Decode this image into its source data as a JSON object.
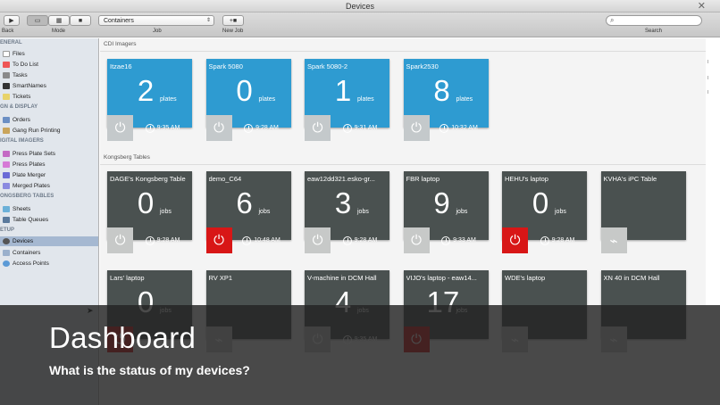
{
  "window": {
    "title": "Devices"
  },
  "toolbar": {
    "back_label": "Back",
    "mode_label": "Mode",
    "job_label": "Job",
    "job_value": "Containers",
    "newjob_label": "New Job",
    "newjob_btn": "+■",
    "search_label": "Search"
  },
  "sidebar": {
    "sections": [
      {
        "title": "ENERAL"
      },
      {
        "title": "GN & DISPLAY"
      },
      {
        "title": "IGITAL IMAGERS"
      },
      {
        "title": "ONGSBERG TABLES"
      },
      {
        "title": "ETUP"
      }
    ],
    "items": [
      {
        "label": "Files"
      },
      {
        "label": "To Do List"
      },
      {
        "label": "Tasks"
      },
      {
        "label": "SmartNames"
      },
      {
        "label": "Tickets"
      },
      {
        "label": "Orders"
      },
      {
        "label": "Gang Run Printing"
      },
      {
        "label": "Press Plate Sets"
      },
      {
        "label": "Press Plates"
      },
      {
        "label": "Plate Merger"
      },
      {
        "label": "Merged Plates"
      },
      {
        "label": "Sheets"
      },
      {
        "label": "Table Queues"
      },
      {
        "label": "Devices"
      },
      {
        "label": "Containers"
      },
      {
        "label": "Access Points"
      }
    ]
  },
  "groups": {
    "cdi": "CDI Imagers",
    "kongsberg": "Kongsberg Tables"
  },
  "cdi_tiles": [
    {
      "name": "Itzae16",
      "count": "2",
      "unit": "plates",
      "time": "9:35 AM",
      "state": "idle"
    },
    {
      "name": "Spark 5080",
      "count": "0",
      "unit": "plates",
      "time": "9:28 AM",
      "state": "idle"
    },
    {
      "name": "Spark 5080-2",
      "count": "1",
      "unit": "plates",
      "time": "9:31 AM",
      "state": "idle"
    },
    {
      "name": "Spark2530",
      "count": "8",
      "unit": "plates",
      "time": "10:32 AM",
      "state": "idle"
    }
  ],
  "table_tiles_row1": [
    {
      "name": "DAGE's Kongsberg Table",
      "count": "0",
      "unit": "jobs",
      "time": "9:28 AM",
      "state": "idle"
    },
    {
      "name": "demo_C64",
      "count": "6",
      "unit": "jobs",
      "time": "10:48 AM",
      "state": "off"
    },
    {
      "name": "eaw12dd321.esko-gr...",
      "count": "3",
      "unit": "jobs",
      "time": "9:28 AM",
      "state": "idle"
    },
    {
      "name": "FBR laptop",
      "count": "9",
      "unit": "jobs",
      "time": "9:33 AM",
      "state": "idle"
    },
    {
      "name": "HEHU's laptop",
      "count": "0",
      "unit": "jobs",
      "time": "9:28 AM",
      "state": "off"
    },
    {
      "name": "KVHA's iPC Table",
      "count": "",
      "unit": "",
      "time": "",
      "state": "disconnected"
    }
  ],
  "table_tiles_row2": [
    {
      "name": "Lars' laptop",
      "count": "0",
      "unit": "jobs",
      "time": "",
      "state": "off"
    },
    {
      "name": "RV XP1",
      "count": "",
      "unit": "",
      "time": "",
      "state": "disconnected"
    },
    {
      "name": "V-machine in DCM Hall",
      "count": "4",
      "unit": "jobs",
      "time": "9:35 AM",
      "state": "idle"
    },
    {
      "name": "VIJO's laptop - eaw14...",
      "count": "17",
      "unit": "jobs",
      "time": "",
      "state": "off"
    },
    {
      "name": "WDE's laptop",
      "count": "",
      "unit": "",
      "time": "",
      "state": "disconnected"
    },
    {
      "name": "XN 40 in DCM Hall",
      "count": "",
      "unit": "",
      "time": "",
      "state": "disconnected"
    }
  ],
  "overlay": {
    "title": "Dashboard",
    "subtitle": "What is the status of my devices?"
  },
  "colors": {
    "cdi_tile": "#2e9bd1",
    "table_tile": "#4a5150",
    "power_off": "#d81616"
  }
}
